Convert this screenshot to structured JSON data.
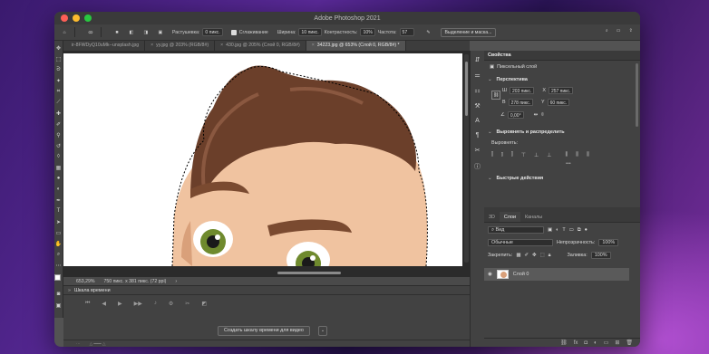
{
  "window": {
    "title": "Adobe Photoshop 2021"
  },
  "options_bar": {
    "feather_label": "Растушевка:",
    "feather_value": "0 пикс.",
    "antialias_label": "Сглаживание",
    "width_label": "Ширина:",
    "width_value": "10 пикс.",
    "contrast_label": "Контрастность:",
    "contrast_value": "10%",
    "frequency_label": "Частота:",
    "frequency_value": "57",
    "select_mask_button": "Выделение и маска..."
  },
  "tabs": [
    {
      "label": "ir-8FWDyQ10uMk--unsplash.jpg",
      "active": false
    },
    {
      "label": "yy.jpg @ 203% (RGB/8#)",
      "active": false
    },
    {
      "label": "430.jpg @ 205% (Слой 0, RGB/8#)",
      "active": false
    },
    {
      "label": "34223.jpg @ 653% (Слой 0, RGB/8#) *",
      "active": true
    }
  ],
  "status": {
    "zoom": "653,29%",
    "doc_info": "750 пикс. x 381 пикс. (72 ppi)"
  },
  "timeline": {
    "title": "Шкала времени",
    "create_button": "Создать шкалу времени для видео"
  },
  "properties": {
    "title": "Свойства",
    "layer_type": "Пиксельный слой",
    "transform_section": "Перспектива",
    "w_label": "Ш",
    "w_value": "203 пикс.",
    "x_label": "X",
    "x_value": "257 пикс.",
    "h_label": "В",
    "h_value": "278 пикс.",
    "y_label": "Y",
    "y_value": "60 пикс.",
    "angle_value": "0,00°",
    "align_section": "Выровнять и распределить",
    "align_label": "Выровнять:",
    "quick_actions_section": "Быстрые действия"
  },
  "layers": {
    "tabs": [
      {
        "label": "3D",
        "active": false
      },
      {
        "label": "Слои",
        "active": true
      },
      {
        "label": "Каналы",
        "active": false
      }
    ],
    "filter_label": "Вид",
    "blend_mode": "Обычные",
    "opacity_label": "Непрозрачность:",
    "opacity_value": "100%",
    "lock_label": "Закрепить:",
    "fill_label": "Заливка:",
    "fill_value": "100%",
    "layer_name": "Слой 0"
  },
  "colors": {
    "panel_bg": "#424242",
    "canvas_bg": "#2b2b2b",
    "hair": "#6b3f2a",
    "skin": "#f0c3a0",
    "eye": "#6f8a2e"
  }
}
